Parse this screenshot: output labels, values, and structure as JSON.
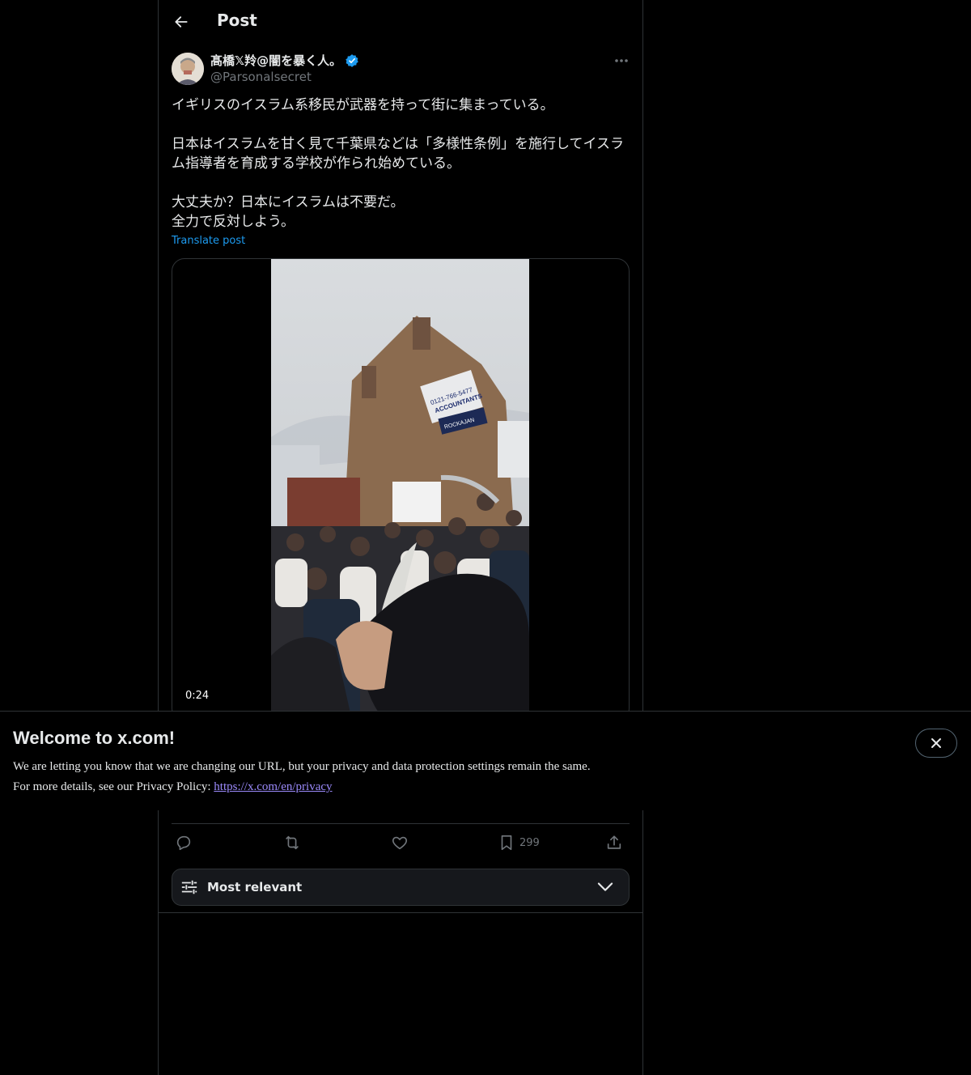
{
  "header": {
    "title": "Post"
  },
  "post": {
    "author_name": "髙橋𝕏羚@闇を暴く人。",
    "handle": "@Parsonalsecret",
    "text": "イギリスのイスラム系移民が武器を持って街に集まっている。\n\n日本はイスラムを甘く見て千葉県などは「多様性条例」を施行してイスラム指導者を育成する学校が作られ始めている。\n\n大丈夫か？日本にイスラムは不要だ。\n全力で反対しよう。",
    "translate_label": "Translate post",
    "video_duration": "0:24",
    "bookmark_count": "299",
    "video_sign_phone": "0121-766-5477",
    "video_sign_business": "ACCOUNTANTS",
    "video_sign_shop": "ROCKAJAN"
  },
  "sort": {
    "label": "Most relevant"
  },
  "banner": {
    "title": "Welcome to x.com!",
    "line1": "We are letting you know that we are changing our URL, but your privacy and data protection settings remain the same.",
    "line2_prefix": "For more details, see our Privacy Policy: ",
    "link": "https://x.com/en/privacy"
  },
  "colors": {
    "accent": "#1d9bf0",
    "verified": "#1d9bf0",
    "link_visited": "#9b8afb",
    "muted": "#71767b"
  },
  "icons": [
    "back-arrow-icon",
    "verified-badge-icon",
    "more-icon",
    "reply-icon",
    "repost-icon",
    "like-icon",
    "bookmark-icon",
    "share-icon",
    "sliders-icon",
    "chevron-down-icon",
    "close-icon"
  ]
}
